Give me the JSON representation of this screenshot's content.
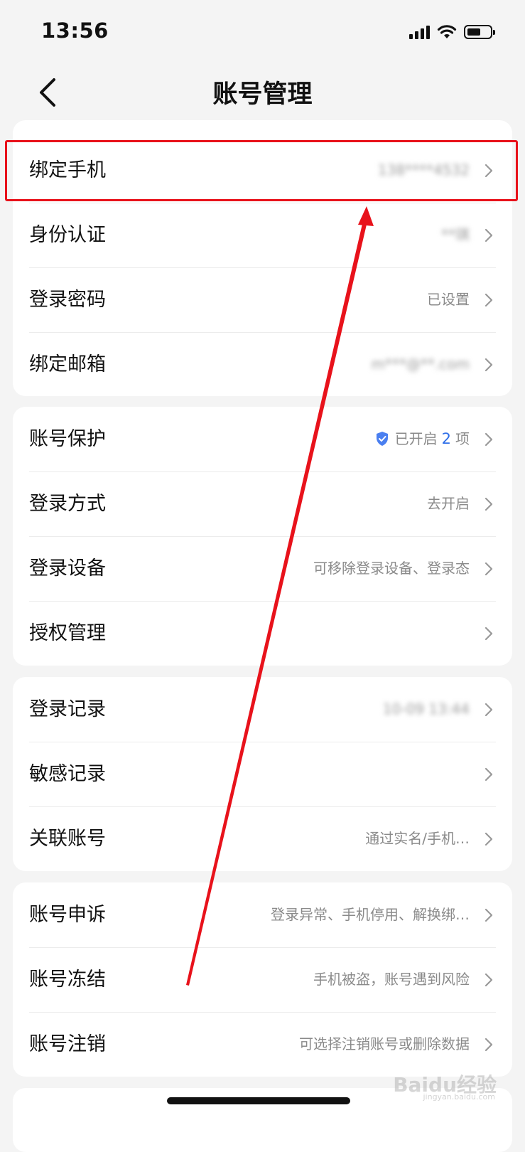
{
  "status_bar": {
    "time": "13:56"
  },
  "nav": {
    "title": "账号管理"
  },
  "groups": [
    {
      "items": [
        {
          "label": "绑定手机",
          "value": "138****4532",
          "blurred": true
        },
        {
          "label": "身份认证",
          "value": "**琪",
          "blurred": true
        },
        {
          "label": "登录密码",
          "value": "已设置"
        },
        {
          "label": "绑定邮箱",
          "value": "m***@**.com",
          "blurred": true
        }
      ]
    },
    {
      "items": [
        {
          "label": "账号保护",
          "value_prefix": "已开启",
          "value_count": "2",
          "value_suffix": "项"
        },
        {
          "label": "登录方式",
          "value": "去开启"
        },
        {
          "label": "登录设备",
          "value": "可移除登录设备、登录态"
        },
        {
          "label": "授权管理",
          "value": ""
        }
      ]
    },
    {
      "items": [
        {
          "label": "登录记录",
          "value": "10-09 13:44",
          "blurred": true
        },
        {
          "label": "敏感记录",
          "value": ""
        },
        {
          "label": "关联账号",
          "value": "通过实名/手机…"
        }
      ]
    },
    {
      "items": [
        {
          "label": "账号申诉",
          "value": "登录异常、手机停用、解换绑…"
        },
        {
          "label": "账号冻结",
          "value": "手机被盗，账号遇到风险"
        },
        {
          "label": "账号注销",
          "value": "可选择注销账号或删除数据"
        }
      ]
    }
  ],
  "watermark": {
    "brand": "Baidu经验",
    "site": "jingyan.baidu.com"
  },
  "colors": {
    "accent": "#2f6fe8",
    "annotation": "#e8121b",
    "background": "#f4f4f4"
  },
  "icons": {
    "back": "chevron-left-icon",
    "row_arrow": "chevron-right-icon",
    "protection": "shield-check-icon"
  }
}
